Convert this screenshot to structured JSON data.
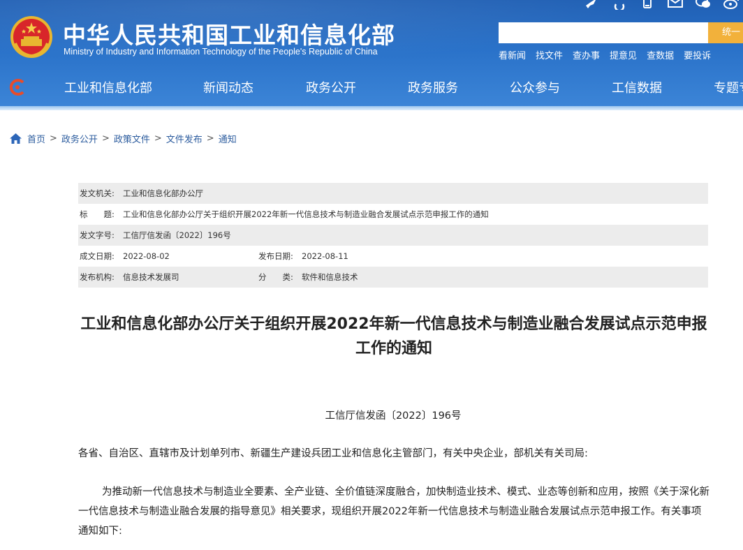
{
  "header": {
    "title_cn": "中华人民共和国工业和信息化部",
    "title_en": "Ministry of Industry and Information Technology of the People's Republic of China",
    "top_icons": [
      "bird-icon",
      "accessibility-icon",
      "mobile-icon",
      "mail-icon",
      "wechat-icon",
      "weibo-icon"
    ],
    "search": {
      "placeholder": "",
      "button": "统一"
    },
    "quick_links": [
      "看新闻",
      "找文件",
      "查办事",
      "提意见",
      "查数据",
      "要投诉"
    ],
    "nav": [
      "工业和信息化部",
      "新闻动态",
      "政务公开",
      "政务服务",
      "公众参与",
      "工信数据",
      "专题专"
    ]
  },
  "breadcrumb": [
    "首页",
    "政务公开",
    "政策文件",
    "文件发布",
    "通知"
  ],
  "meta": {
    "issuer_label": "发文机关:",
    "issuer": "工业和信息化部办公厅",
    "title_label": "标　　题:",
    "title": "工业和信息化部办公厅关于组织开展2022年新一代信息技术与制造业融合发展试点示范申报工作的通知",
    "docno_label": "发文字号:",
    "docno": "工信厅信发函〔2022〕196号",
    "created_label": "成文日期:",
    "created": "2022-08-02",
    "published_label": "发布日期:",
    "published": "2022-08-11",
    "org_label": "发布机构:",
    "org": "信息技术发展司",
    "category_label": "分　　类:",
    "category": "软件和信息技术"
  },
  "article": {
    "title": "工业和信息化部办公厅关于组织开展2022年新一代信息技术与制造业融合发展试点示范申报工作的通知",
    "doc_number": "工信厅信发函〔2022〕196号",
    "paragraph1": "各省、自治区、直辖市及计划单列市、新疆生产建设兵团工业和信息化主管部门，有关中央企业，部机关有关司局:",
    "paragraph2": "为推动新一代信息技术与制造业全要素、全产业链、全价值链深度融合，加快制造业技术、模式、业态等创新和应用，按照《关于深化新一代信息技术与制造业融合发展的指导意见》相关要求，现组织开展2022年新一代信息技术与制造业融合发展试点示范申报工作。有关事项通知如下:"
  },
  "colors": {
    "header_blue": "#2a72c9",
    "search_button": "#f2b13b",
    "link": "#2c5c9e",
    "meta_shade": "#ececec"
  }
}
